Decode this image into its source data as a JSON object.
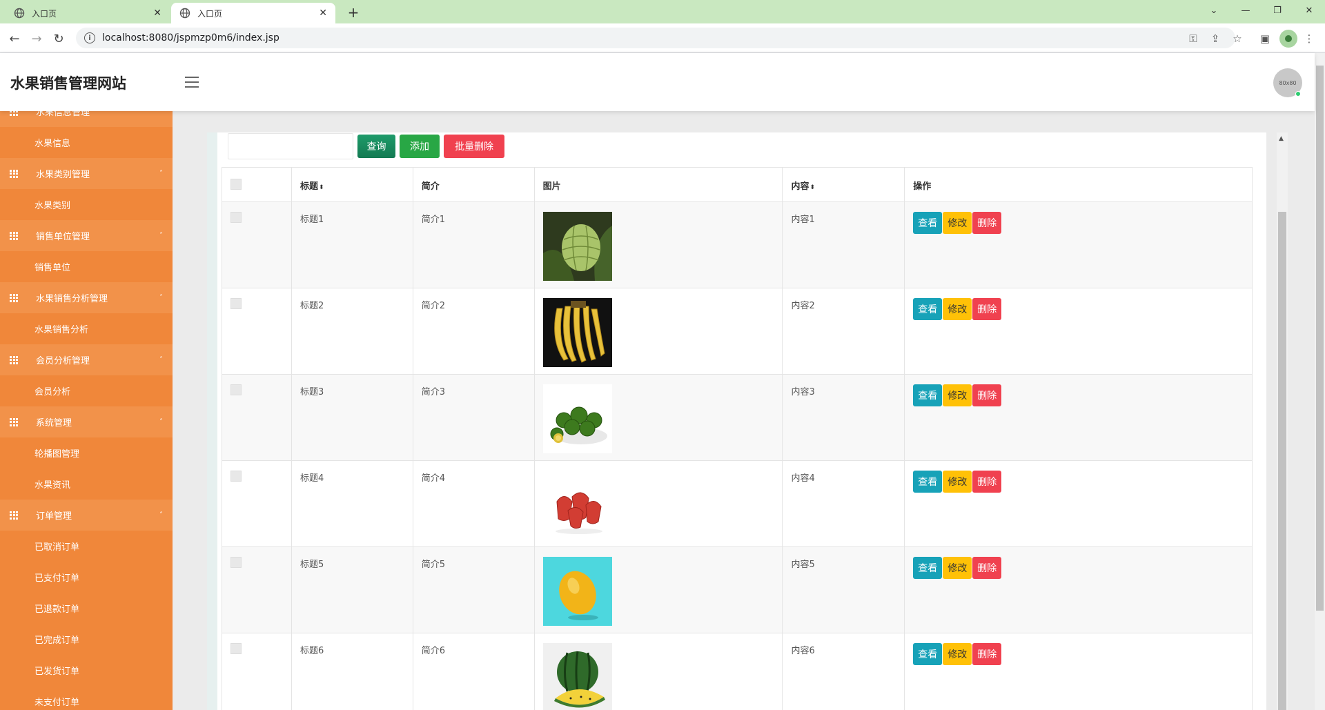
{
  "browser": {
    "tabs": [
      {
        "title": "入口页",
        "active": false
      },
      {
        "title": "入口页",
        "active": true
      }
    ],
    "url": "localhost:8080/jspmzp0m6/index.jsp"
  },
  "header": {
    "site_title": "水果销售管理网站",
    "avatar_text": "80x80"
  },
  "sidebar": {
    "rows": [
      {
        "type": "group",
        "label": "水果信息管理"
      },
      {
        "type": "item",
        "label": "水果信息"
      },
      {
        "type": "group",
        "label": "水果类别管理"
      },
      {
        "type": "item",
        "label": "水果类别"
      },
      {
        "type": "group",
        "label": "销售单位管理"
      },
      {
        "type": "item",
        "label": "销售单位"
      },
      {
        "type": "group",
        "label": "水果销售分析管理"
      },
      {
        "type": "item",
        "label": "水果销售分析"
      },
      {
        "type": "group",
        "label": "会员分析管理"
      },
      {
        "type": "item",
        "label": "会员分析"
      },
      {
        "type": "group",
        "label": "系统管理"
      },
      {
        "type": "item",
        "label": "轮播图管理"
      },
      {
        "type": "item",
        "label": "水果资讯"
      },
      {
        "type": "group",
        "label": "订单管理"
      },
      {
        "type": "item",
        "label": "已取消订单"
      },
      {
        "type": "item",
        "label": "已支付订单"
      },
      {
        "type": "item",
        "label": "已退款订单"
      },
      {
        "type": "item",
        "label": "已完成订单"
      },
      {
        "type": "item",
        "label": "已发货订单"
      },
      {
        "type": "item",
        "label": "未支付订单"
      }
    ]
  },
  "toolbar": {
    "search_placeholder": "",
    "search_label": "查询",
    "add_label": "添加",
    "batch_delete_label": "批量删除"
  },
  "table": {
    "columns": [
      "标题",
      "简介",
      "图片",
      "内容",
      "操作"
    ],
    "rows": [
      {
        "title": "标题1",
        "intro": "简介1",
        "image": "custard-apple",
        "content": "内容1"
      },
      {
        "title": "标题2",
        "intro": "简介2",
        "image": "bananas",
        "content": "内容2"
      },
      {
        "title": "标题3",
        "intro": "简介3",
        "image": "green-kumquats",
        "content": "内容3"
      },
      {
        "title": "标题4",
        "intro": "简介4",
        "image": "wax-apples",
        "content": "内容4"
      },
      {
        "title": "标题5",
        "intro": "简介5",
        "image": "lemon",
        "content": "内容5"
      },
      {
        "title": "标题6",
        "intro": "简介6",
        "image": "watermelon",
        "content": "内容6"
      }
    ],
    "actions": {
      "view": "查看",
      "edit": "修改",
      "delete": "删除"
    }
  },
  "colors": {
    "sidebar_bg": "#f0873a",
    "sidebar_group_bg": "#f2924a",
    "btn_view": "#17a2b8",
    "btn_edit": "#ffc107",
    "btn_delete": "#f0414f",
    "btn_add": "#28a745",
    "btn_search": "#137a52"
  }
}
